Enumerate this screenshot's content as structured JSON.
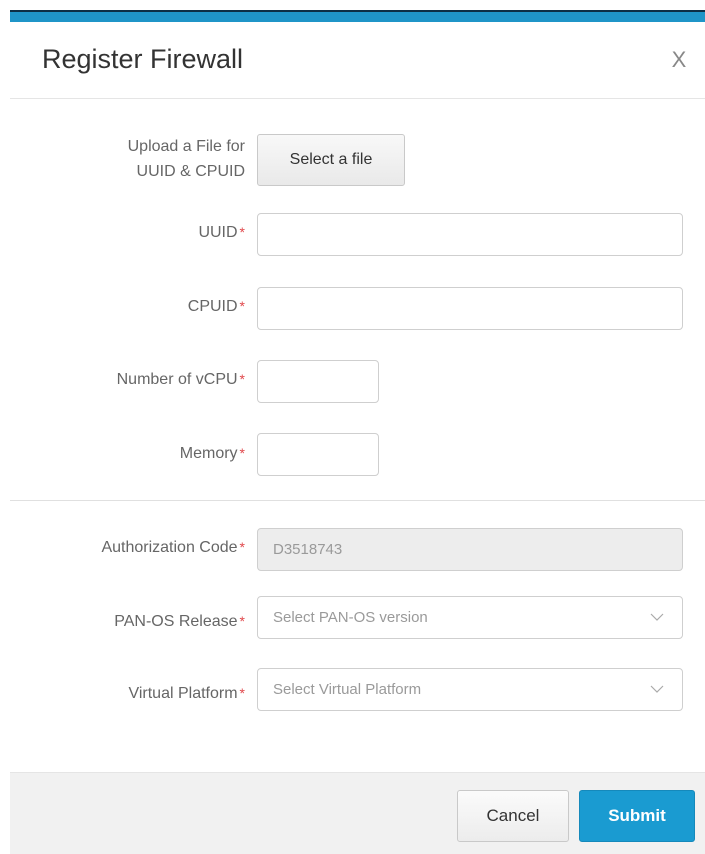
{
  "dialog": {
    "title": "Register Firewall",
    "close_label": "X"
  },
  "form": {
    "upload": {
      "label_line1": "Upload a File for",
      "label_line2": "UUID & CPUID",
      "button_label": "Select a file"
    },
    "uuid": {
      "label": "UUID",
      "value": ""
    },
    "cpuid": {
      "label": "CPUID",
      "value": ""
    },
    "vcpu": {
      "label": "Number of vCPU",
      "value": ""
    },
    "memory": {
      "label": "Memory",
      "value": ""
    },
    "auth_code": {
      "label": "Authorization Code",
      "value": "D3518743"
    },
    "panos_release": {
      "label": "PAN-OS Release",
      "placeholder": "Select PAN-OS version"
    },
    "virtual_platform": {
      "label": "Virtual Platform",
      "placeholder": "Select Virtual Platform"
    },
    "required_marker": "*"
  },
  "footer": {
    "cancel_label": "Cancel",
    "submit_label": "Submit"
  },
  "colors": {
    "accent": "#1a9bd1",
    "required": "#e0464a"
  }
}
